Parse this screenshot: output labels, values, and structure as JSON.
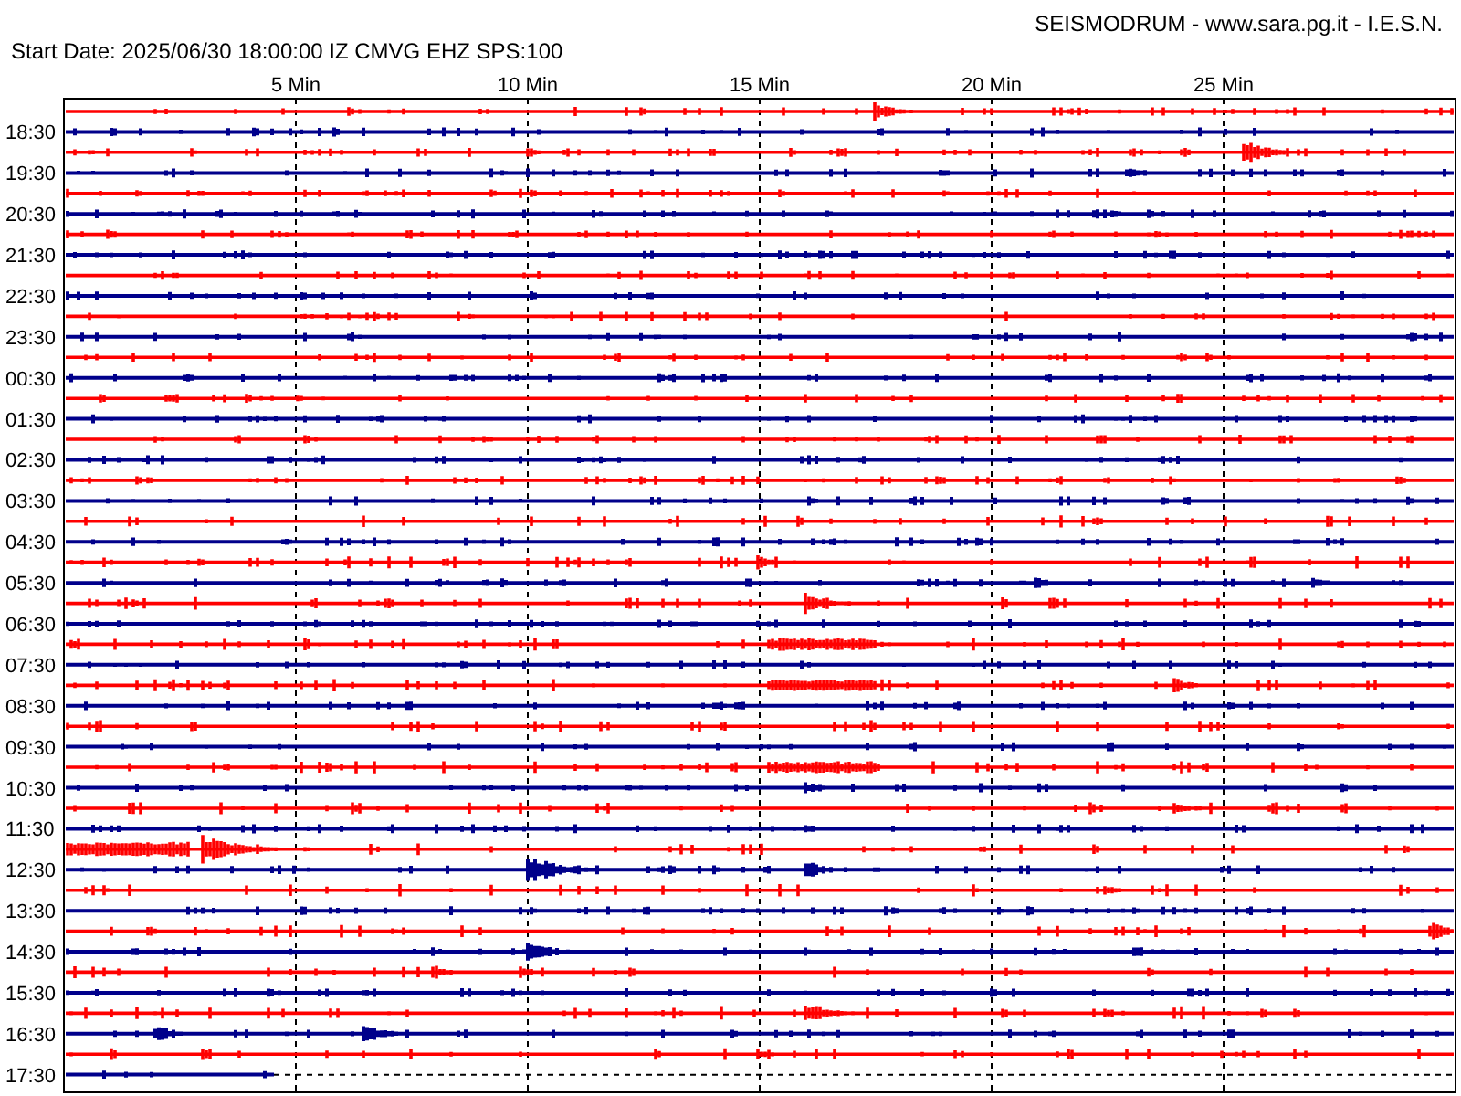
{
  "header": {
    "title": "SEISMODRUM - www.sara.pg.it - I.E.S.N.",
    "start_date": "Start Date: 2025/06/30 18:00:00 IZ CMVG EHZ SPS:100"
  },
  "minute_labels": [
    "5 Min",
    "10 Min",
    "15 Min",
    "20 Min",
    "25 Min"
  ],
  "hour_labels": [
    "18:30",
    "19:30",
    "20:30",
    "21:30",
    "22:30",
    "23:30",
    "00:30",
    "01:30",
    "02:30",
    "03:30",
    "04:30",
    "05:30",
    "06:30",
    "07:30",
    "08:30",
    "09:30",
    "10:30",
    "11:30",
    "12:30",
    "13:30",
    "14:30",
    "15:30",
    "16:30",
    "17:30"
  ]
}
